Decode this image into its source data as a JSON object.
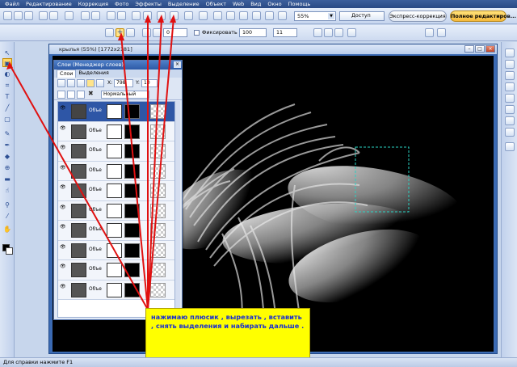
{
  "menu": [
    "Файл",
    "Редактирование",
    "Коррекция",
    "Фото",
    "Эффекты",
    "Выделение",
    "Объект",
    "Web",
    "Вид",
    "Окно",
    "Помощь"
  ],
  "toolbar": {
    "zoom": "55%",
    "access_label": "Доступ",
    "express_label": "Экспресс-коррекция",
    "full_label": "Полное редактиров..."
  },
  "options": {
    "fix_label": "Фиксировать",
    "width_value": "100",
    "height_value": "11"
  },
  "document": {
    "title": "крылья (55%) [1772x2181]"
  },
  "layers_panel": {
    "title": "Слои (Менеджер слоев)",
    "tabs": [
      "Слои",
      "Выделения"
    ],
    "x_value": "798",
    "y_value": "10",
    "blend_mode": "Нормальный",
    "layer_name": "Объе",
    "layer_count": 10
  },
  "annotation": {
    "text": "нажимаю плюсик , вырезать , вставить , снять выделения и набирать дальше ."
  },
  "status": {
    "hint": "Для справки нажмите F1"
  },
  "colors": {
    "note_bg": "#ffff00",
    "note_text": "#1a2fd0",
    "arrow": "#e01010"
  }
}
